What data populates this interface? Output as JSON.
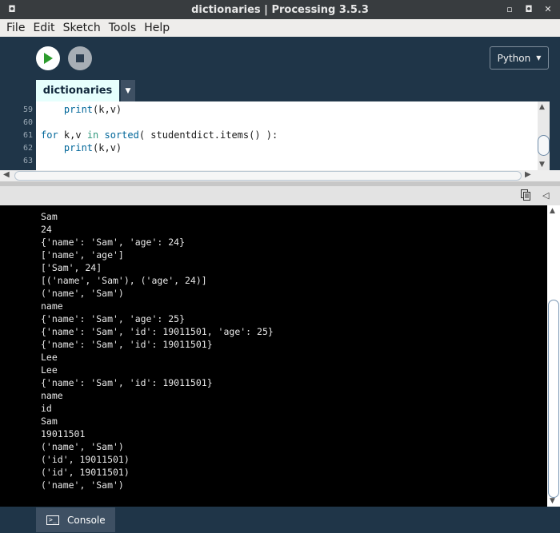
{
  "window": {
    "title": "dictionaries | Processing 3.5.3"
  },
  "menu": [
    "File",
    "Edit",
    "Sketch",
    "Tools",
    "Help"
  ],
  "toolbar": {
    "mode_label": "Python"
  },
  "tabs": {
    "active": "dictionaries"
  },
  "editor": {
    "lines": [
      {
        "num": "59",
        "text": "    print(k,v)"
      },
      {
        "num": "60",
        "text": ""
      },
      {
        "num": "61",
        "text": "for k,v in sorted( studentdict.items() ):"
      },
      {
        "num": "62",
        "text": "    print(k,v)"
      },
      {
        "num": "63",
        "text": ""
      }
    ]
  },
  "console": {
    "lines": [
      "Sam",
      "24",
      "{'name': 'Sam', 'age': 24}",
      "['name', 'age']",
      "['Sam', 24]",
      "[('name', 'Sam'), ('age', 24)]",
      "('name', 'Sam')",
      "name",
      "{'name': 'Sam', 'age': 25}",
      "{'name': 'Sam', 'id': 19011501, 'age': 25}",
      "{'name': 'Sam', 'id': 19011501}",
      "Lee",
      "Lee",
      "{'name': 'Sam', 'id': 19011501}",
      "name",
      "id",
      "Sam",
      "19011501",
      "('name', 'Sam')",
      "('id', 19011501)",
      "('id', 19011501)",
      "('name', 'Sam')"
    ]
  },
  "footer": {
    "console_tab_label": "Console"
  },
  "colors": {
    "toolbar_bg": "#1f3548",
    "tab_active_bg": "#e6fffd",
    "run_icon": "#2d9c2d",
    "console_bg": "#000000"
  }
}
